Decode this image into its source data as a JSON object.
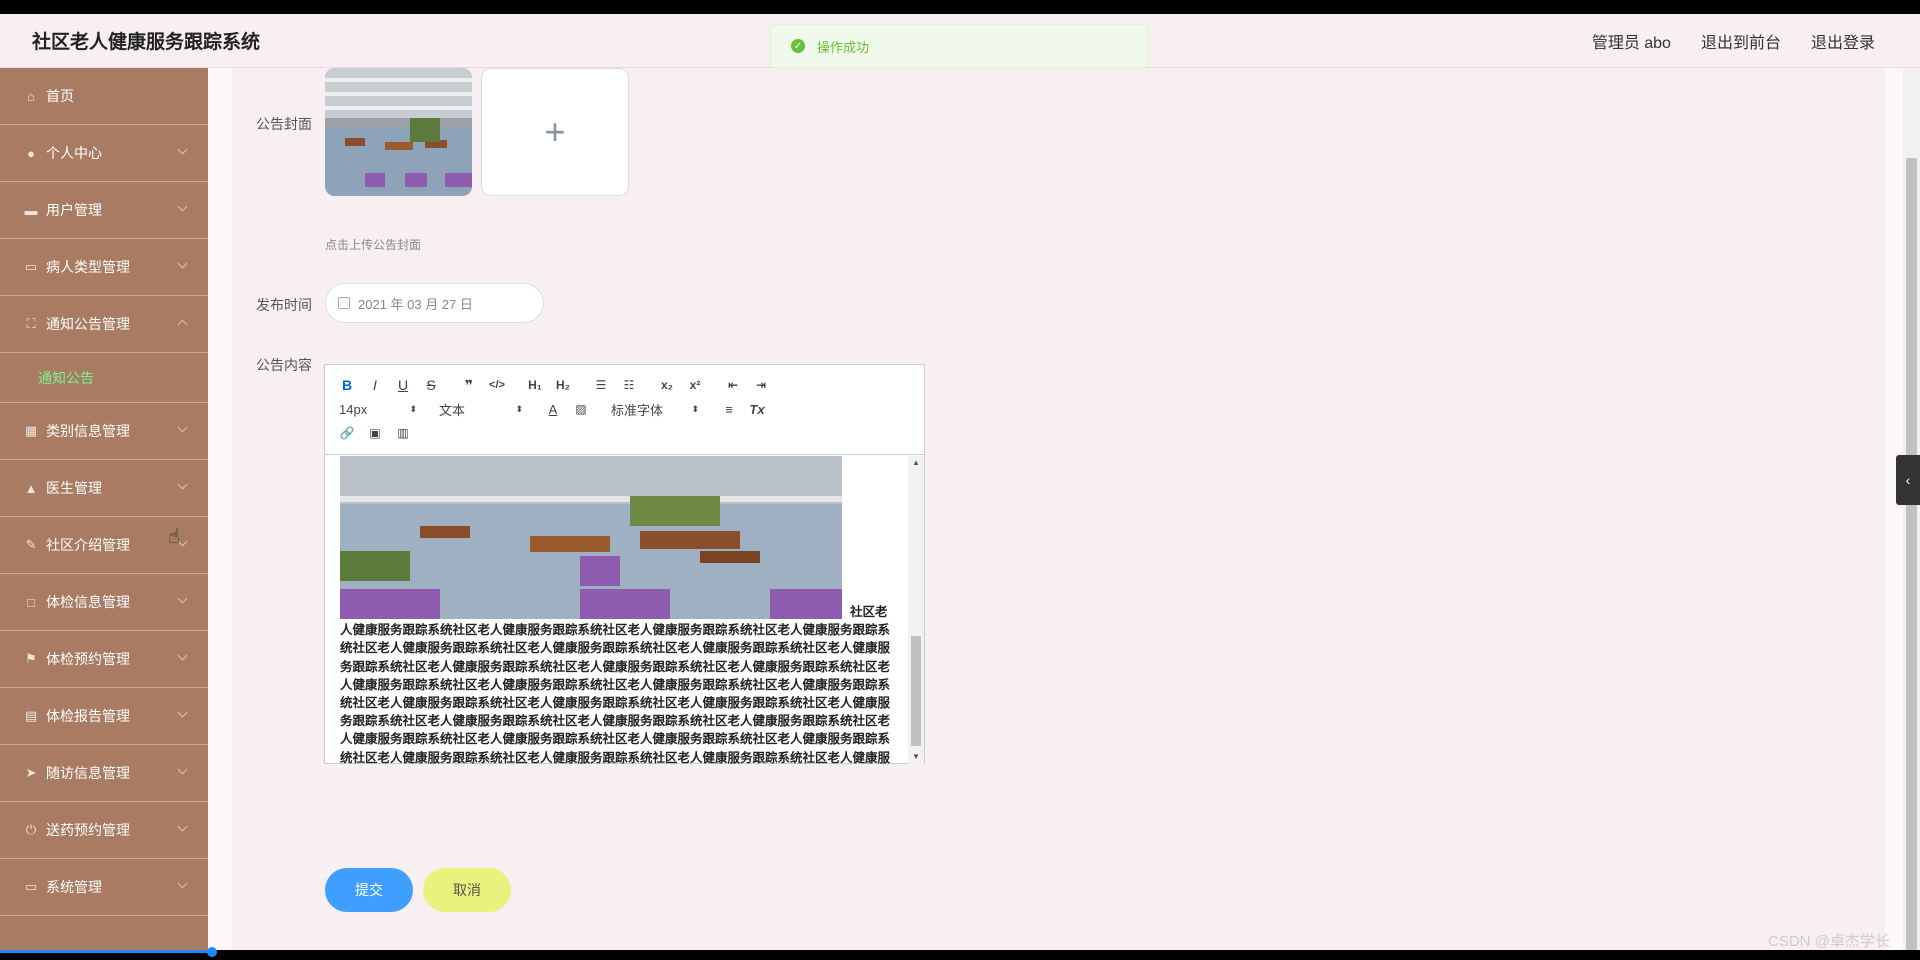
{
  "app": {
    "title": "社区老人健康服务跟踪系统",
    "user_label": "管理员 abo",
    "front_link": "退出到前台",
    "logout_link": "退出登录"
  },
  "toast": {
    "message": "操作成功",
    "color": "#67c23a"
  },
  "sidebar": {
    "items": [
      {
        "label": "首页",
        "icon": "home-icon"
      },
      {
        "label": "个人中心",
        "icon": "user-icon"
      },
      {
        "label": "用户管理",
        "icon": "users-icon"
      },
      {
        "label": "病人类型管理",
        "icon": "monitor-icon"
      },
      {
        "label": "通知公告管理",
        "icon": "frame-icon",
        "expanded": true
      },
      {
        "label": "类别信息管理",
        "icon": "grid-icon"
      },
      {
        "label": "医生管理",
        "icon": "doctor-icon"
      },
      {
        "label": "社区介绍管理",
        "icon": "edit-icon"
      },
      {
        "label": "体检信息管理",
        "icon": "square-icon"
      },
      {
        "label": "体检预约管理",
        "icon": "flag-icon"
      },
      {
        "label": "体检报告管理",
        "icon": "clipboard-icon"
      },
      {
        "label": "随访信息管理",
        "icon": "send-icon"
      },
      {
        "label": "送药预约管理",
        "icon": "power-icon"
      },
      {
        "label": "系统管理",
        "icon": "monitor-icon"
      }
    ],
    "active_sub": "通知公告",
    "accent_color": "#7cf58c",
    "bg_color": "#a97b62"
  },
  "form": {
    "cover_label": "公告封面",
    "cover_hint": "点击上传公告封面",
    "date_label": "发布时间",
    "date_value": "2021 年 03 月 27 日",
    "content_label": "公告内容",
    "editor": {
      "font_size": "14px",
      "format": "文本",
      "font_family": "标准字体",
      "text": "社区老人健康服务跟踪系统社区老人健康服务跟踪系统社区老人健康服务跟踪系统社区老人健康服务跟踪系统社区老人健康服务跟踪系统社区老人健康服务跟踪系统社区老人健康服务跟踪系统社区老人健康服务跟踪系统社区老人健康服务跟踪系统社区老人健康服务跟踪系统社区老人健康服务跟踪系统社区老人健康服务跟踪系统社区老人健康服务跟踪系统社区老人健康服务跟踪系统社区老人健康服务跟踪系统社区老人健康服务跟踪系统社区老人健康服务跟踪系统社区老人健康服务跟踪系统社区老人健康服务跟踪系统社区老人健康服务跟踪系统社区老人健康服务跟踪系统社区老人健康服务跟踪系统社区老人健康服务跟踪系统社区老人健康服务跟踪系统社区老人健康服务跟踪系统社区老人健康服务跟踪系统社区老人健康服务跟踪系统社区老人健康服务跟踪系统社区老人健康服务跟踪系统社区老人健康服务跟踪系统社区老人健康服务跟踪系统社区老人健康服务跟踪系统社区老人健康服务跟踪系统社区老人健康服务跟踪系统"
    },
    "submit_label": "提交",
    "cancel_label": "取消",
    "submit_color": "#409eff",
    "cancel_color": "#e9f27c"
  },
  "watermark": "CSDN @卓杰学长"
}
